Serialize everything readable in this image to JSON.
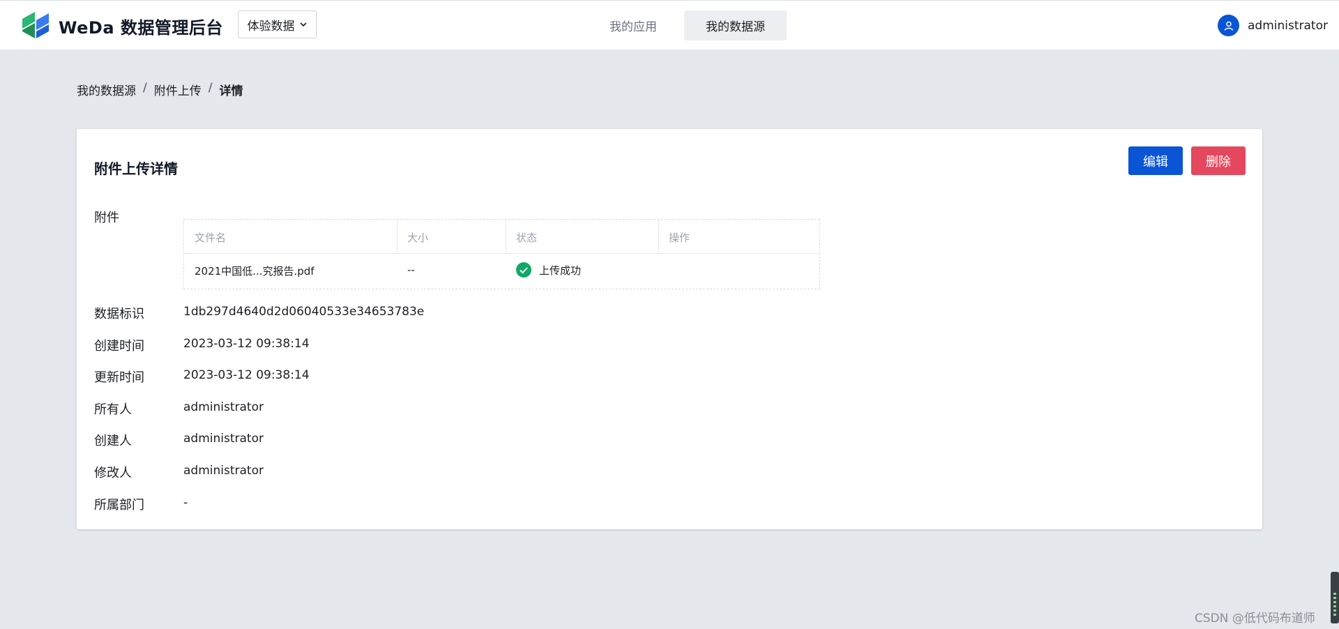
{
  "header": {
    "brand": "WeDa 数据管理后台",
    "env_select": "体验数据",
    "tabs": [
      {
        "label": "我的应用",
        "active": false
      },
      {
        "label": "我的数据源",
        "active": true
      }
    ],
    "user_name": "administrator"
  },
  "breadcrumb": {
    "items": [
      "我的数据源",
      "附件上传",
      "详情"
    ],
    "separator": "/"
  },
  "detail": {
    "title": "附件上传详情",
    "edit_label": "编辑",
    "delete_label": "删除",
    "attachment_label": "附件",
    "attachment_table": {
      "columns": [
        "文件名",
        "大小",
        "状态",
        "操作"
      ],
      "rows": [
        {
          "name": "2021中国低...究报告.pdf",
          "size": "--",
          "status": "上传成功",
          "action": ""
        }
      ]
    },
    "fields": [
      {
        "label": "数据标识",
        "value": "1db297d4640d2d06040533e34653783e"
      },
      {
        "label": "创建时间",
        "value": "2023-03-12 09:38:14"
      },
      {
        "label": "更新时间",
        "value": "2023-03-12 09:38:14"
      },
      {
        "label": "所有人",
        "value": "administrator"
      },
      {
        "label": "创建人",
        "value": "administrator"
      },
      {
        "label": "修改人",
        "value": "administrator"
      },
      {
        "label": "所属部门",
        "value": "-"
      }
    ]
  },
  "watermark": "CSDN @低代码布道师",
  "colors": {
    "primary": "#0a55d6",
    "danger": "#e5485e",
    "success": "#0fa968",
    "page_bg": "#e4e7eb"
  }
}
